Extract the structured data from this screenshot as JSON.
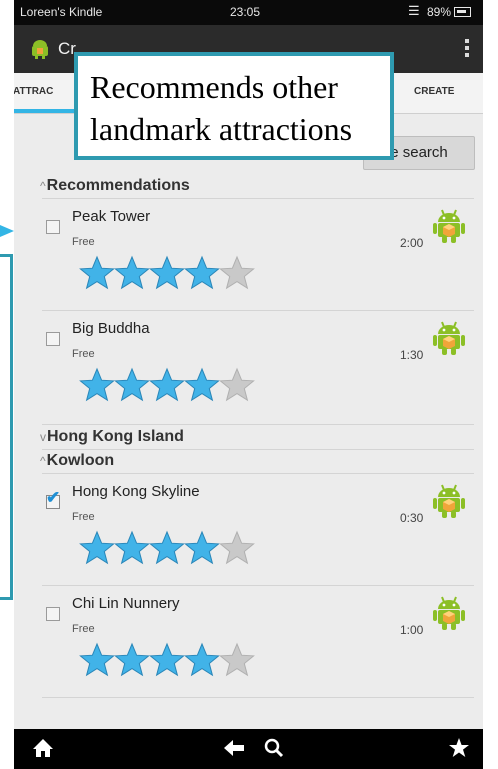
{
  "status_bar": {
    "device_name": "Loreen's Kindle",
    "time": "23:05",
    "battery": "89%"
  },
  "action_bar": {
    "title": "Cr"
  },
  "tabs": [
    {
      "label": "ATTRAC",
      "active": true
    },
    {
      "label": "CREATE",
      "active": false
    }
  ],
  "search_button": {
    "label": "e search"
  },
  "sections": {
    "recommendations": "Recommendations",
    "hong_kong_island": "Hong Kong Island",
    "kowloon": "Kowloon"
  },
  "recommendations": [
    {
      "title": "Peak Tower",
      "price": "Free",
      "duration": "2:00",
      "rating": 4,
      "max_rating": 5,
      "checked": false
    },
    {
      "title": "Big Buddha",
      "price": "Free",
      "duration": "1:30",
      "rating": 4,
      "max_rating": 5,
      "checked": false
    }
  ],
  "kowloon": [
    {
      "title": "Hong Kong Skyline",
      "price": "Free",
      "duration": "0:30",
      "rating": 4,
      "max_rating": 5,
      "checked": true
    },
    {
      "title": "Chi Lin Nunnery",
      "price": "Free",
      "duration": "1:00",
      "rating": 4,
      "max_rating": 5,
      "checked": false
    }
  ],
  "annotation": {
    "line1": "Recommends other",
    "line2": "landmark attractions"
  },
  "icons": {
    "app": "android-icon",
    "item": "android-package-icon",
    "nav": [
      "home-icon",
      "back-icon",
      "search-icon",
      "favorites-star-icon"
    ]
  },
  "colors": {
    "accent": "#33b5e5",
    "star_on": "#41b3e8",
    "star_off": "#c9c9c9",
    "droid": "#8cbf26",
    "callout_border": "#2e9ab0"
  }
}
